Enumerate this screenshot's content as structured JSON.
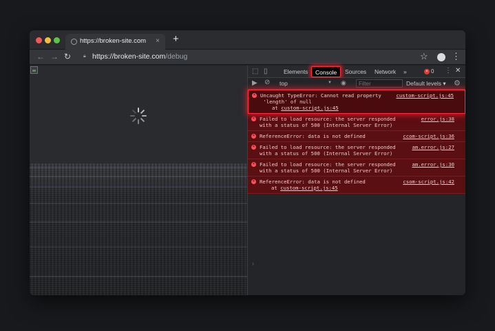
{
  "browser": {
    "tab_title": "https://broken-site.com",
    "tab_close": "×",
    "new_tab": "+",
    "url_host": "https://broken-site.com",
    "url_path": "/debug"
  },
  "devtools": {
    "tabs": [
      "Elements",
      "Console",
      "Sources",
      "Network"
    ],
    "active_tab": "Console",
    "more_tabs": "»",
    "error_count": "0",
    "context": "top",
    "filter_placeholder": "Filter",
    "levels": "Default levels ▾",
    "prompt": "›"
  },
  "console": [
    {
      "text": "Uncaught TypeError: Cannot read property\n 'length' of null",
      "source": "custom-script.js:45",
      "stack_prefix": "at ",
      "stack_link": "custom-script.js:45",
      "highlight": true
    },
    {
      "text": "Failed to load resource: the server responded\nwith a status of 500 (Internal Server Error)",
      "source": "error.js:38"
    },
    {
      "text": "ReferenceError: data is not defined",
      "source": "ccom-script.js:36"
    },
    {
      "text": "Failed to load resource: the server responded\nwith a status of 500 (Internal Server Error)",
      "source": "am.error.js:27"
    },
    {
      "text": "Failed to load resource: the server responded\nwith a status of 500 (Internal Server Error)",
      "source": "am.error.js:30"
    },
    {
      "text": "ReferenceError: data is not defined",
      "source": "csom-script.js:42",
      "stack_prefix": "at ",
      "stack_link": "custom-script.js:45"
    }
  ],
  "colors": {
    "error_bg": "#5a0f12",
    "highlight_glow": "#ff2d3d",
    "page_bg": "#17191c"
  },
  "icons": {
    "back": "arrow-left-icon",
    "forward": "arrow-right-icon",
    "reload": "reload-icon",
    "lock": "lock-icon",
    "star": "star-icon",
    "account": "account-icon",
    "menu": "kebab-menu-icon",
    "spinner": "loading-spinner-icon",
    "broken_image": "broken-image-icon"
  }
}
